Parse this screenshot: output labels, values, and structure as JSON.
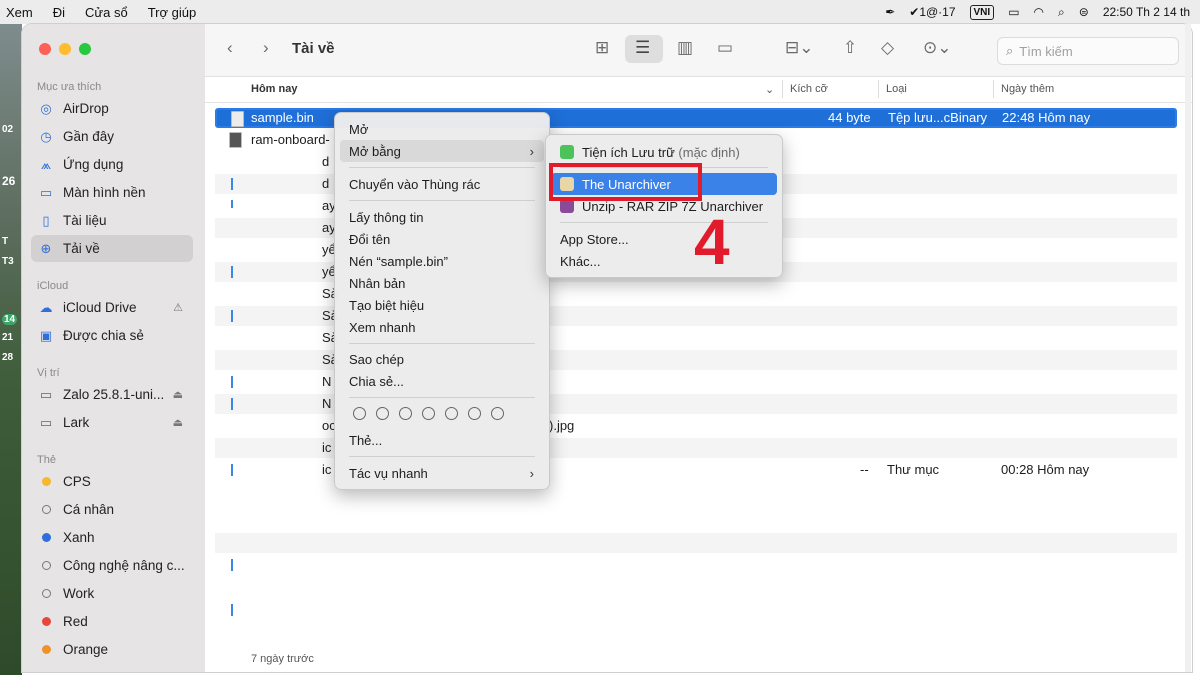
{
  "menubar": {
    "items": [
      "Xem",
      "Đi",
      "Cửa sổ",
      "Trợ giúp"
    ],
    "battery_status": "1@·17",
    "input_method": "VNI",
    "clock": "22:50 Th 2 14 th"
  },
  "desktop": {
    "numbers": [
      "02",
      "26",
      "T",
      "T3",
      "14",
      "21",
      "28"
    ]
  },
  "window": {
    "title": "Tài về",
    "search_placeholder": "Tìm kiếm"
  },
  "sidebar": {
    "favorites_header": "Mục ưa thích",
    "favorites": [
      {
        "label": "AirDrop",
        "icon": "airdrop-icon"
      },
      {
        "label": "Gần đây",
        "icon": "clock-icon"
      },
      {
        "label": "Ứng dụng",
        "icon": "apps-icon"
      },
      {
        "label": "Màn hình nền",
        "icon": "desktop-icon"
      },
      {
        "label": "Tài liệu",
        "icon": "document-icon"
      },
      {
        "label": "Tải về",
        "icon": "download-icon"
      }
    ],
    "icloud_header": "iCloud",
    "icloud": [
      {
        "label": "iCloud Drive",
        "icon": "cloud-icon"
      },
      {
        "label": "Được chia sẻ",
        "icon": "shared-folder-icon"
      }
    ],
    "location_header": "Vị trí",
    "locations": [
      {
        "label": "Zalo 25.8.1-uni..."
      },
      {
        "label": "Lark"
      }
    ],
    "tags_header": "Thẻ",
    "tags": [
      {
        "label": "CPS",
        "color": "#f5b82e"
      },
      {
        "label": "Cá nhân",
        "color": ""
      },
      {
        "label": "Xanh",
        "color": "#2f6fdb"
      },
      {
        "label": "Công nghệ nâng c...",
        "color": ""
      },
      {
        "label": "Work",
        "color": ""
      },
      {
        "label": "Red",
        "color": "#e8463b"
      },
      {
        "label": "Orange",
        "color": "#f0922b"
      }
    ]
  },
  "columns": {
    "name": "Hôm nay",
    "size": "Kích cỡ",
    "kind": "Loại",
    "date": "Ngày thêm"
  },
  "files": {
    "selected": {
      "name": "sample.bin",
      "size": "44 byte",
      "kind": "Tệp lưu...cBinary",
      "date": "22:48 Hôm nay"
    },
    "second": {
      "name": "ram-onboard-"
    },
    "partial_names": [
      "d",
      "d",
      "ay",
      "ay",
      "yể",
      "yể",
      "Sà",
      "Sà",
      "Sà",
      "Sà",
      "N",
      "N",
      "oc",
      "ic",
      "ic"
    ],
    "jpg_fragment": ").jpg",
    "folder_row": {
      "size": "--",
      "kind": "Thư mục",
      "date": "00:28 Hôm nay"
    },
    "section_label": "7 ngày trước"
  },
  "context_menu": {
    "items": [
      "Mở",
      "Mở bằng",
      "Chuyển vào Thùng rác",
      "Lấy thông tin",
      "Đổi tên",
      "Nén “sample.bin”",
      "Nhân bản",
      "Tạo biệt hiệu",
      "Xem nhanh",
      "Sao chép",
      "Chia sẻ...",
      "Thẻ...",
      "Tác vụ nhanh"
    ]
  },
  "submenu": {
    "default_app": "Tiện ích Lưu trữ",
    "default_suffix": "(mặc định)",
    "apps": [
      "The Unarchiver",
      "Unzip - RAR ZIP 7Z Unarchiver"
    ],
    "app_store": "App Store...",
    "other": "Khác..."
  },
  "annotation": {
    "step": "4",
    "color": "#e21b2c"
  }
}
